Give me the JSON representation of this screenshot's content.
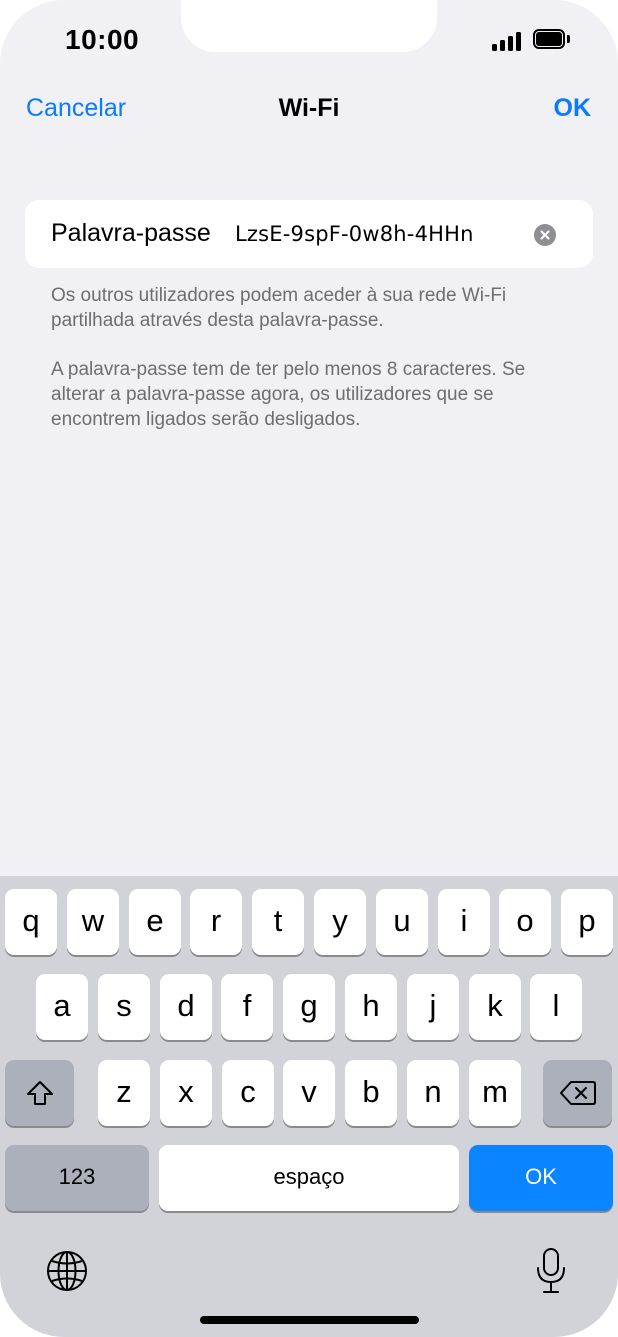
{
  "status_bar": {
    "time": "10:00",
    "signal_icon": "cellular-signal-icon",
    "battery_icon": "battery-icon"
  },
  "nav": {
    "cancel_label": "Cancelar",
    "title": "Wi-Fi",
    "ok_label": "OK"
  },
  "password_field": {
    "label": "Palavra-passe",
    "value": "LzsE-9spF-0w8h-4HHn",
    "clear_icon": "clear-text-icon"
  },
  "hints": {
    "sharing": "Os outros utilizadores podem aceder à sua rede Wi-Fi partilhada através desta palavra-passe.",
    "requirements": "A palavra-passe tem de ter pelo menos 8 caracteres. Se alterar a palavra-passe agora, os utilizadores que se encontrem ligados serão desligados."
  },
  "keyboard": {
    "row1": [
      "q",
      "w",
      "e",
      "r",
      "t",
      "y",
      "u",
      "i",
      "o",
      "p"
    ],
    "row2": [
      "a",
      "s",
      "d",
      "f",
      "g",
      "h",
      "j",
      "k",
      "l"
    ],
    "row3": [
      "z",
      "x",
      "c",
      "v",
      "b",
      "n",
      "m"
    ],
    "shift_icon": "shift-icon",
    "delete_icon": "delete-backspace-icon",
    "numbers_label": "123",
    "space_label": "espaço",
    "return_label": "OK",
    "globe_icon": "globe-icon",
    "mic_icon": "microphone-icon"
  },
  "colors": {
    "accent": "#0a7aff",
    "background": "#f0f0f5",
    "keyboard_bg": "#d1d3d9",
    "return_key": "#0a84ff"
  }
}
